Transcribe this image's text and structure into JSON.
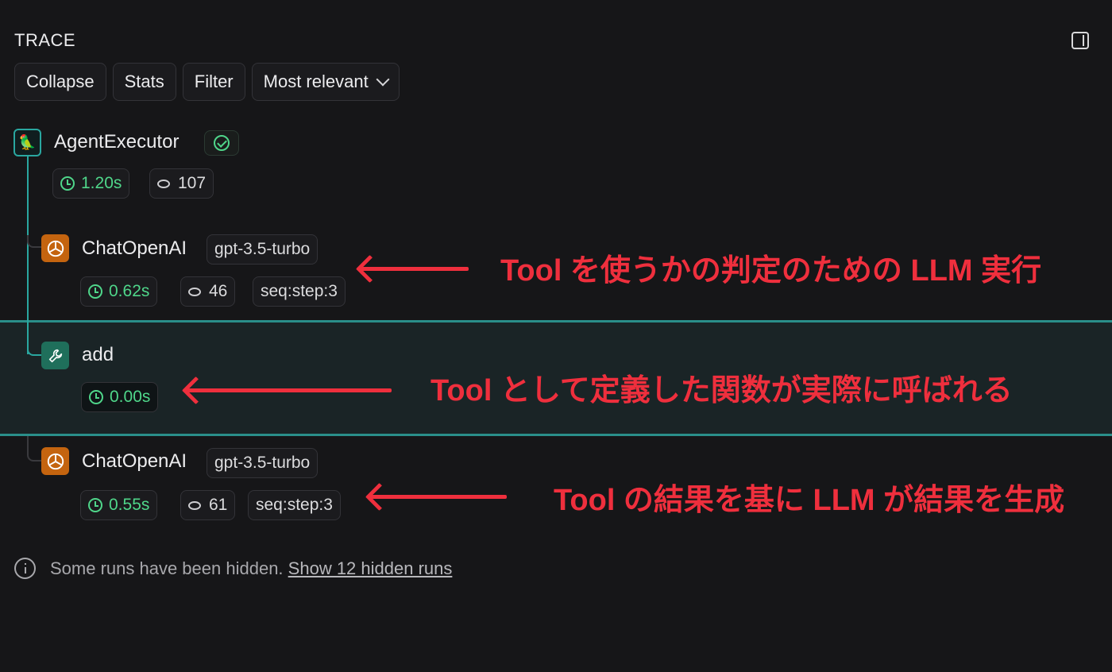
{
  "header": {
    "title": "TRACE"
  },
  "toolbar": {
    "collapse": "Collapse",
    "stats": "Stats",
    "filter": "Filter",
    "sort": "Most relevant"
  },
  "runs": [
    {
      "name": "AgentExecutor",
      "status": "success",
      "latency": "1.20s",
      "tokens": "107"
    },
    {
      "name": "ChatOpenAI",
      "model": "gpt-3.5-turbo",
      "latency": "0.62s",
      "tokens": "46",
      "tag": "seq:step:3"
    },
    {
      "name": "add",
      "latency": "0.00s"
    },
    {
      "name": "ChatOpenAI",
      "model": "gpt-3.5-turbo",
      "latency": "0.55s",
      "tokens": "61",
      "tag": "seq:step:3"
    }
  ],
  "annotations": [
    "Tool を使うかの判定のための LLM 実行",
    "Tool として定義した関数が実際に呼ばれる",
    "Tool の結果を基に LLM が結果を生成"
  ],
  "footer": {
    "message": "Some runs have been hidden.",
    "link": "Show 12 hidden runs"
  },
  "colors": {
    "accent": "#2aa7a0",
    "success": "#4fd68a",
    "annotation": "#ef2f3d",
    "openai": "#c4640f",
    "tool": "#1f6f5b"
  }
}
